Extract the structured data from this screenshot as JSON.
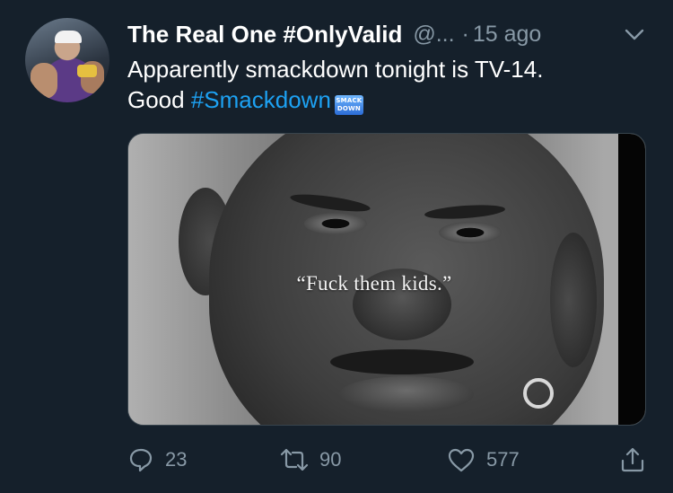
{
  "tweet": {
    "display_name": "The Real One #OnlyValid",
    "handle": "@...",
    "separator": "·",
    "timestamp": "15 ago",
    "text_line1": "Apparently smackdown tonight is TV-14.",
    "text_word": "Good",
    "hashtag": "#Smackdown",
    "hashtag_logo": {
      "line1": "SMACK",
      "line2": "DOWN"
    },
    "media": {
      "caption": "“Fuck them kids.”"
    }
  },
  "actions": {
    "reply_count": "23",
    "retweet_count": "90",
    "like_count": "577"
  },
  "icons": {
    "menu": "chevron-down-icon",
    "reply": "reply-icon",
    "retweet": "retweet-icon",
    "like": "heart-icon",
    "share": "share-icon"
  },
  "colors": {
    "background": "#15202b",
    "secondary_text": "#8899a6",
    "link": "#1da1f2",
    "border": "#38444d"
  }
}
